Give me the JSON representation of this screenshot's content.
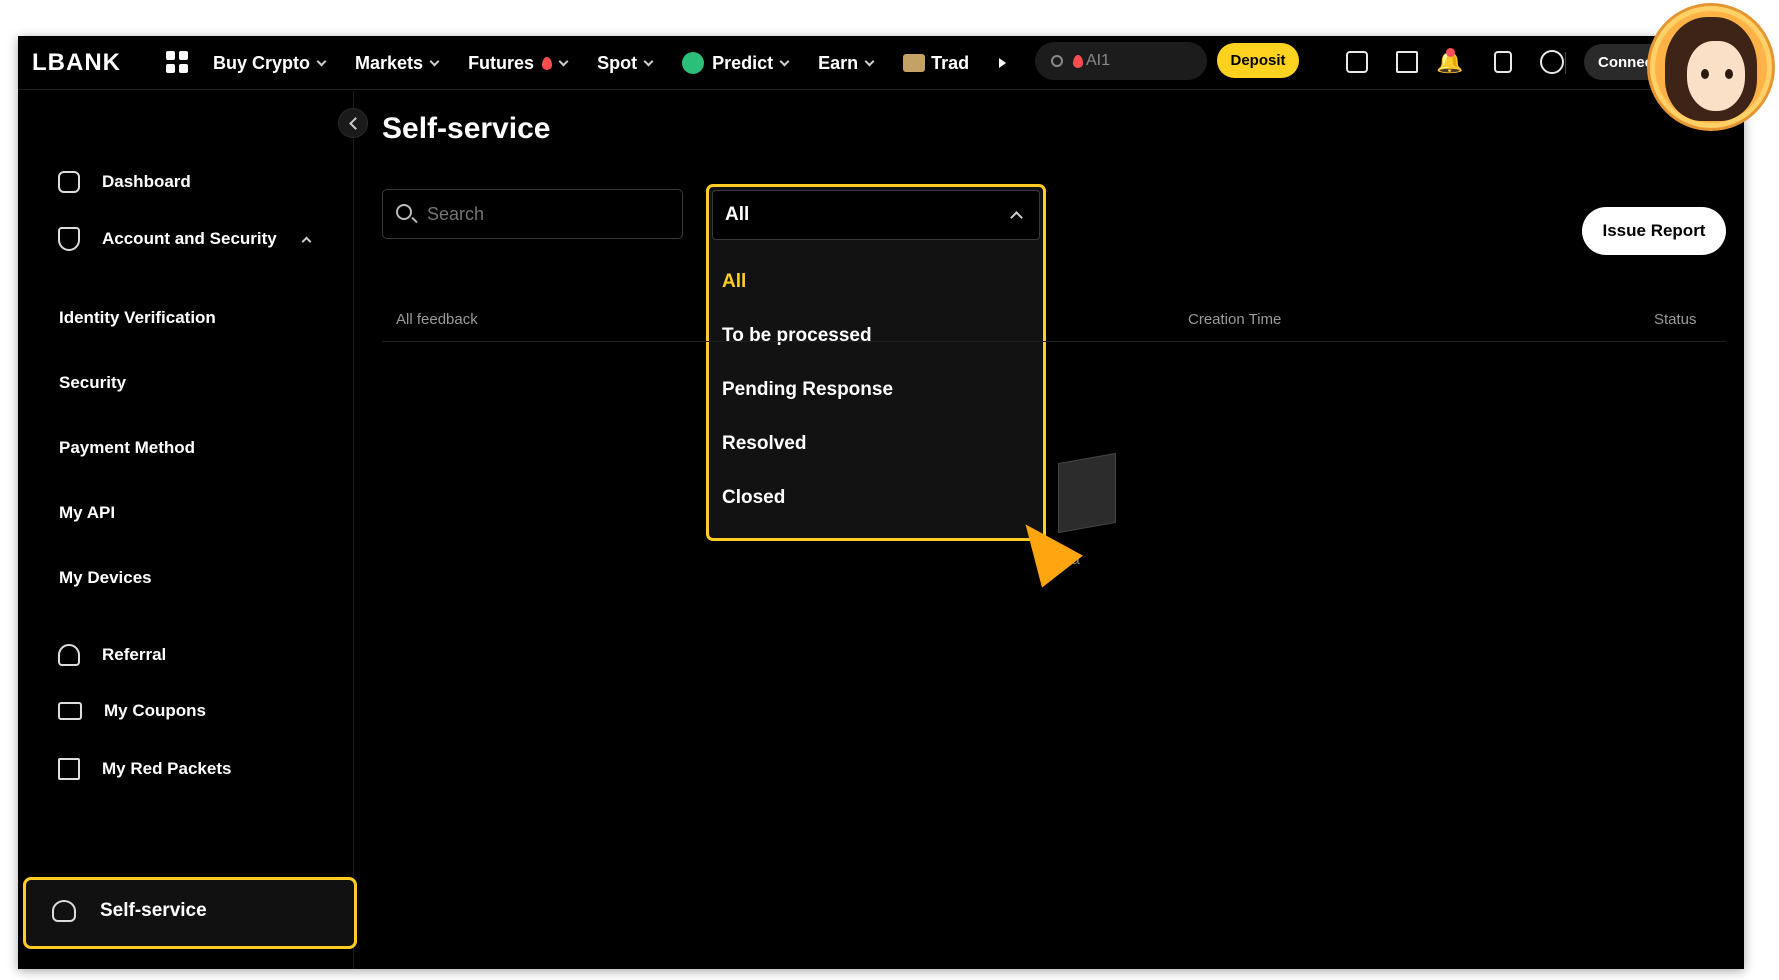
{
  "topbar": {
    "logo": "LBANK",
    "nav": [
      {
        "label": "Buy Crypto"
      },
      {
        "label": "Markets"
      },
      {
        "label": "Futures"
      },
      {
        "label": "Spot"
      },
      {
        "label": "Predict"
      },
      {
        "label": "Earn"
      },
      {
        "label": "Trad"
      }
    ],
    "search_text": "AI1",
    "deposit_label": "Deposit",
    "connect_label": "Connect"
  },
  "sidebar": {
    "dashboard": "Dashboard",
    "account_security": "Account and Security",
    "sub_items": [
      "Identity Verification",
      "Security",
      "Payment Method",
      "My API",
      "My Devices"
    ],
    "referral": "Referral",
    "coupons": "My Coupons",
    "red_packets": "My Red Packets",
    "self_service": "Self-service"
  },
  "main": {
    "title": "Self-service",
    "search_placeholder": "Search",
    "filter": {
      "selected": "All",
      "options": [
        "All",
        "To be processed",
        "Pending Response",
        "Resolved",
        "Closed"
      ]
    },
    "issue_report_label": "Issue Report",
    "columns": {
      "feedback": "All feedback",
      "creation_time": "Creation Time",
      "status": "Status"
    },
    "empty_text": "o data"
  },
  "colors": {
    "accent": "#ffcc23",
    "deposit": "#ffd21f",
    "background": "#000000"
  }
}
